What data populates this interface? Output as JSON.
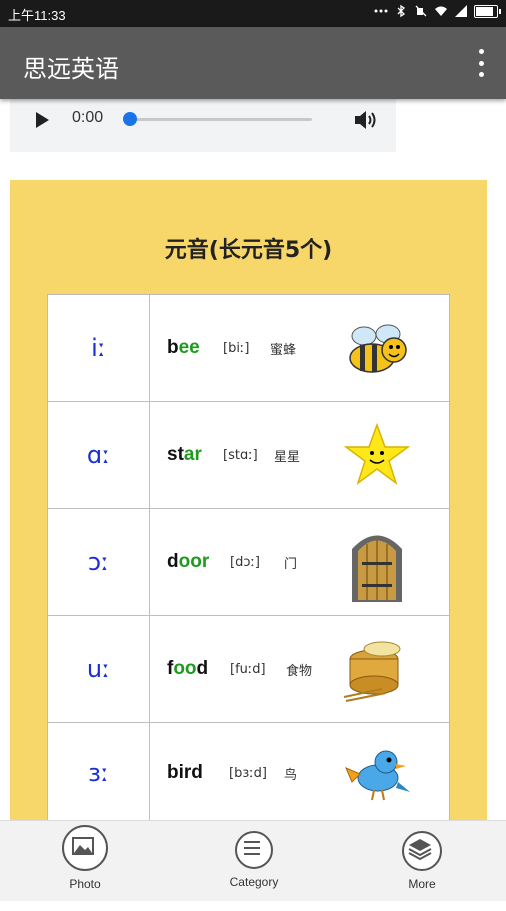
{
  "status_bar": {
    "time": "上午11:33"
  },
  "app_bar": {
    "title": "思远英语"
  },
  "audio_player": {
    "time": "0:00"
  },
  "card": {
    "heading": "元音(长元音5个)",
    "rows": [
      {
        "symbol": "iː",
        "word_a": "b",
        "word_b": "ee",
        "phonetic": "[biː]",
        "meaning": "蜜蜂",
        "image": "bee-icon"
      },
      {
        "symbol": "ɑː",
        "word_a": "st",
        "word_b": "ar",
        "phonetic": "[stɑː]",
        "meaning": "星星",
        "image": "star-icon"
      },
      {
        "symbol": "ɔː",
        "word_a": "d",
        "word_b": "oor",
        "phonetic": "[dɔː]",
        "meaning": "门",
        "image": "door-icon"
      },
      {
        "symbol": "uː",
        "word_a": "f",
        "word_b": "oo",
        "word_c": "d",
        "phonetic": "[fuːd]",
        "meaning": "食物",
        "image": "food-icon"
      },
      {
        "symbol": "ɜː",
        "word_a": "bird",
        "word_b": "",
        "phonetic": "[bɜːd]",
        "meaning": "鸟",
        "image": "bird-icon"
      }
    ]
  },
  "bottom_nav": [
    {
      "label": "Photo",
      "icon": "photo-icon"
    },
    {
      "label": "Category",
      "icon": "list-icon"
    },
    {
      "label": "More",
      "icon": "layers-icon"
    }
  ],
  "colors": {
    "card": "#f8d76a",
    "appbar": "#5a5a5a",
    "symbol": "#1a2fd6",
    "highlight": "#1f9b1f"
  }
}
